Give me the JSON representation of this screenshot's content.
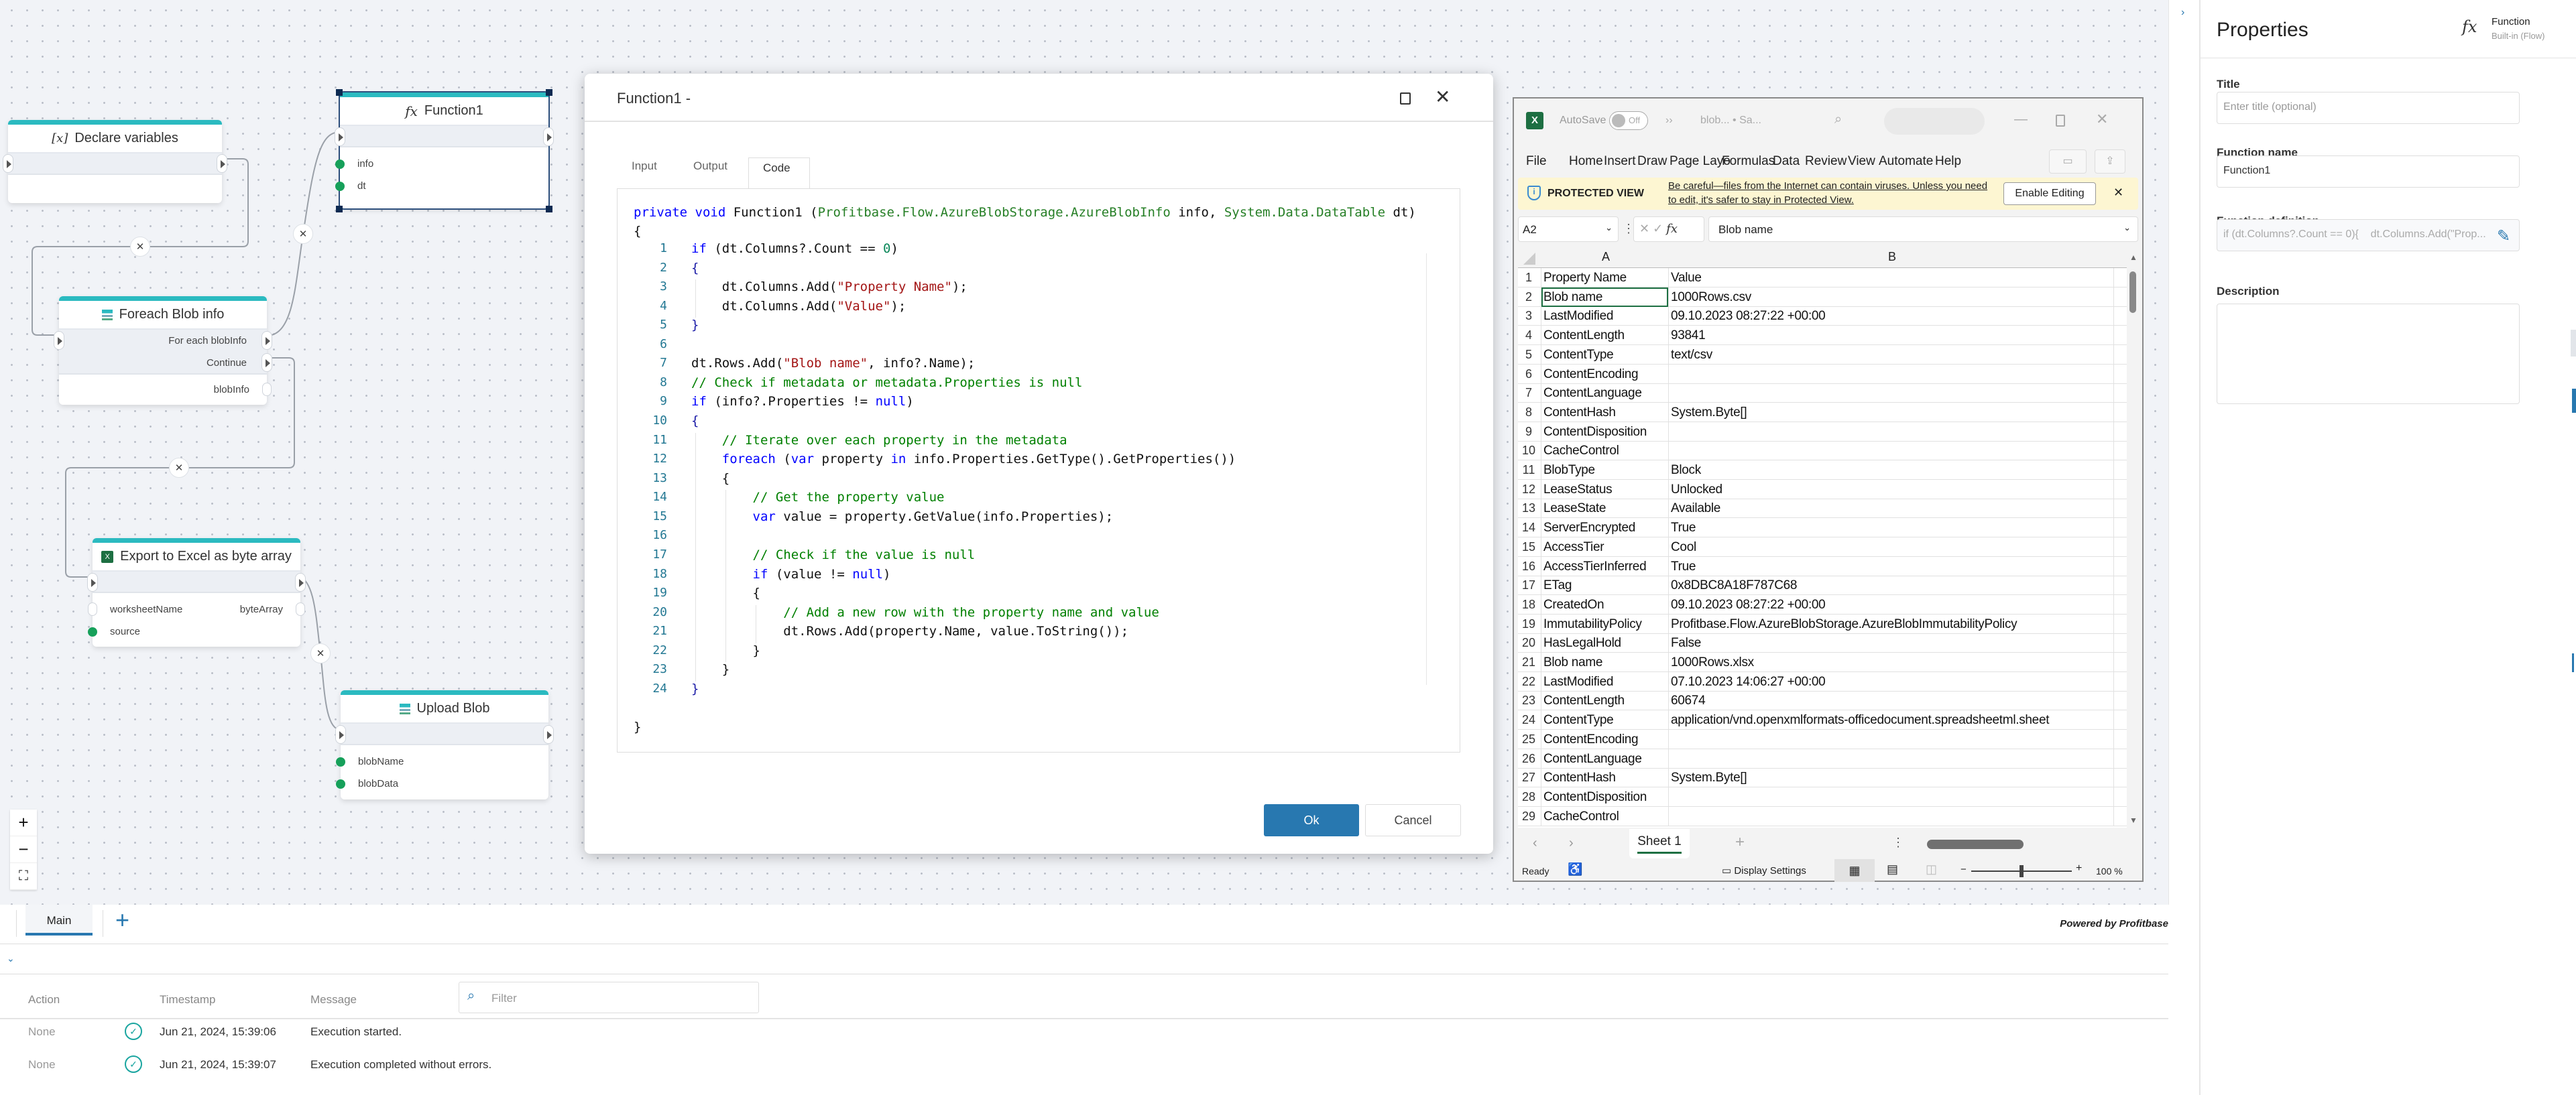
{
  "canvas": {
    "nodes": {
      "declare": {
        "title": "Declare variables",
        "icon": "variable-icon"
      },
      "function1": {
        "title": "Function1",
        "icon": "fx-icon",
        "inputs": [
          "info",
          "dt"
        ]
      },
      "foreach": {
        "title": "Foreach Blob info",
        "icon": "stack-icon",
        "outputs": [
          "For each blobInfo",
          "Continue"
        ],
        "values": [
          "blobInfo"
        ]
      },
      "export": {
        "title": "Export to Excel as byte array",
        "icon": "excel-icon",
        "inputs": [
          "worksheetName",
          "source"
        ],
        "outputs": [
          "byteArray"
        ]
      },
      "upload": {
        "title": "Upload Blob",
        "icon": "stack-icon",
        "inputs": [
          "blobName",
          "blobData"
        ]
      }
    },
    "zoom_controls": {
      "in": "+",
      "out": "−",
      "fit": "⛶"
    },
    "accent": "#2bbac0"
  },
  "dialog": {
    "title": "Function1 -",
    "tabs": [
      "Input",
      "Output",
      "Code"
    ],
    "active_tab": "Code",
    "signature": [
      [
        "private void",
        "kw"
      ],
      [
        " Function1 (",
        ""
      ],
      [
        "Profitbase.Flow.AzureBlobStorage.AzureBlobInfo",
        "ty"
      ],
      [
        " info, ",
        ""
      ],
      [
        "System.Data.DataTable",
        "ty"
      ],
      [
        " dt)",
        ""
      ]
    ],
    "open_brace": "{",
    "close_brace": "}",
    "code_lines": [
      [
        [
          "if",
          "kw"
        ],
        [
          " (dt.Columns?.Count == ",
          ""
        ],
        [
          "0",
          "nu"
        ],
        [
          ")",
          ""
        ]
      ],
      [
        [
          "{",
          "pn"
        ]
      ],
      [
        [
          "    dt.Columns.Add(",
          ""
        ],
        [
          "\"Property Name\"",
          "st"
        ],
        [
          ");",
          ""
        ]
      ],
      [
        [
          "    dt.Columns.Add(",
          ""
        ],
        [
          "\"Value\"",
          "st"
        ],
        [
          ");",
          ""
        ]
      ],
      [
        [
          "}",
          "pn"
        ]
      ],
      [],
      [
        [
          "dt.Rows.Add(",
          ""
        ],
        [
          "\"Blob name\"",
          "st"
        ],
        [
          ", info?.Name);",
          ""
        ]
      ],
      [
        [
          "// Check if metadata or metadata.Properties is null",
          "cm"
        ]
      ],
      [
        [
          "if",
          "kw"
        ],
        [
          " (info?.Properties != ",
          ""
        ],
        [
          "null",
          "kw"
        ],
        [
          ")",
          ""
        ]
      ],
      [
        [
          "{",
          "pn"
        ]
      ],
      [
        [
          "    // Iterate over each property in the metadata",
          "cm"
        ]
      ],
      [
        [
          "    ",
          ""
        ],
        [
          "foreach",
          "kw"
        ],
        [
          " (",
          ""
        ],
        [
          "var",
          "kw"
        ],
        [
          " property ",
          ""
        ],
        [
          "in",
          "kw"
        ],
        [
          " info.Properties.GetType().GetProperties())",
          ""
        ]
      ],
      [
        [
          "    {",
          ""
        ]
      ],
      [
        [
          "        // Get the property value",
          "cm"
        ]
      ],
      [
        [
          "        ",
          ""
        ],
        [
          "var",
          "kw"
        ],
        [
          " value = property.GetValue(info.Properties);",
          ""
        ]
      ],
      [],
      [
        [
          "        // Check if the value is null",
          "cm"
        ]
      ],
      [
        [
          "        ",
          ""
        ],
        [
          "if",
          "kw"
        ],
        [
          " (value != ",
          ""
        ],
        [
          "null",
          "kw"
        ],
        [
          ")",
          ""
        ]
      ],
      [
        [
          "        {",
          ""
        ]
      ],
      [
        [
          "            // Add a new row with the property name and value",
          "cm"
        ]
      ],
      [
        [
          "            dt.Rows.Add(property.Name, value.ToString());",
          ""
        ]
      ],
      [
        [
          "        }",
          ""
        ]
      ],
      [
        [
          "    }",
          ""
        ]
      ],
      [
        [
          "}",
          "pn"
        ]
      ]
    ],
    "ok_label": "Ok",
    "cancel_label": "Cancel",
    "ok_color": "#2878b0"
  },
  "excel": {
    "autosave_label": "AutoSave",
    "autosave_state": "Off",
    "file_title": "blob... • Sa...",
    "menu": [
      "File",
      "Home",
      "Insert",
      "Draw",
      "Page Layo",
      "Formulas",
      "Data",
      "Review",
      "View",
      "Automate",
      "Help"
    ],
    "protected_title": "PROTECTED VIEW",
    "protected_message": "Be careful—files from the Internet can contain viruses. Unless you need to edit, it's safer to stay in Protected View.",
    "enable_editing": "Enable Editing",
    "name_box": "A2",
    "formula": "Blob name",
    "columns": [
      "A",
      "B"
    ],
    "rows": [
      [
        "Property Name",
        "Value"
      ],
      [
        "Blob name",
        "1000Rows.csv"
      ],
      [
        "LastModified",
        "09.10.2023 08:27:22 +00:00"
      ],
      [
        "ContentLength",
        "93841"
      ],
      [
        "ContentType",
        "text/csv"
      ],
      [
        "ContentEncoding",
        ""
      ],
      [
        "ContentLanguage",
        ""
      ],
      [
        "ContentHash",
        "System.Byte[]"
      ],
      [
        "ContentDisposition",
        ""
      ],
      [
        "CacheControl",
        ""
      ],
      [
        "BlobType",
        "Block"
      ],
      [
        "LeaseStatus",
        "Unlocked"
      ],
      [
        "LeaseState",
        "Available"
      ],
      [
        "ServerEncrypted",
        "True"
      ],
      [
        "AccessTier",
        "Cool"
      ],
      [
        "AccessTierInferred",
        "True"
      ],
      [
        "ETag",
        "0x8DBC8A18F787C68"
      ],
      [
        "CreatedOn",
        "09.10.2023 08:27:22 +00:00"
      ],
      [
        "ImmutabilityPolicy",
        "Profitbase.Flow.AzureBlobStorage.AzureBlobImmutabilityPolicy"
      ],
      [
        "HasLegalHold",
        "False"
      ],
      [
        "Blob name",
        "1000Rows.xlsx"
      ],
      [
        "LastModified",
        "07.10.2023 14:06:27 +00:00"
      ],
      [
        "ContentLength",
        "60674"
      ],
      [
        "ContentType",
        "application/vnd.openxmlformats-officedocument.spreadsheetml.sheet"
      ],
      [
        "ContentEncoding",
        ""
      ],
      [
        "ContentLanguage",
        ""
      ],
      [
        "ContentHash",
        "System.Byte[]"
      ],
      [
        "ContentDisposition",
        ""
      ],
      [
        "CacheControl",
        ""
      ]
    ],
    "sheet_tab": "Sheet 1",
    "status": "Ready",
    "display_settings": "Display Settings",
    "zoom": "100 %",
    "zoom_fraction": 0.5,
    "brand_color": "#1d6f42"
  },
  "properties": {
    "header": "Properties",
    "type_name": "Function",
    "type_sub": "Built-in (Flow)",
    "title_label": "Title",
    "title_placeholder": "Enter title (optional)",
    "function_name_label": "Function name",
    "function_name_value": "Function1",
    "definition_label": "Function definition",
    "definition_value": "if (dt.Columns?.Count == 0){    dt.Columns.Add(\"Prop...",
    "description_label": "Description"
  },
  "bottom": {
    "tabs": [
      "Main"
    ],
    "add_tab": "+",
    "powered_by": "Powered by Profitbase",
    "log_headers": [
      "Action",
      "Timestamp",
      "Message"
    ],
    "filter_placeholder": "Filter",
    "log_rows": [
      {
        "action": "None",
        "status": "success",
        "timestamp": "Jun 21, 2024, 15:39:06",
        "message": "Execution started."
      },
      {
        "action": "None",
        "status": "success",
        "timestamp": "Jun 21, 2024, 15:39:07",
        "message": "Execution completed without errors."
      }
    ]
  }
}
